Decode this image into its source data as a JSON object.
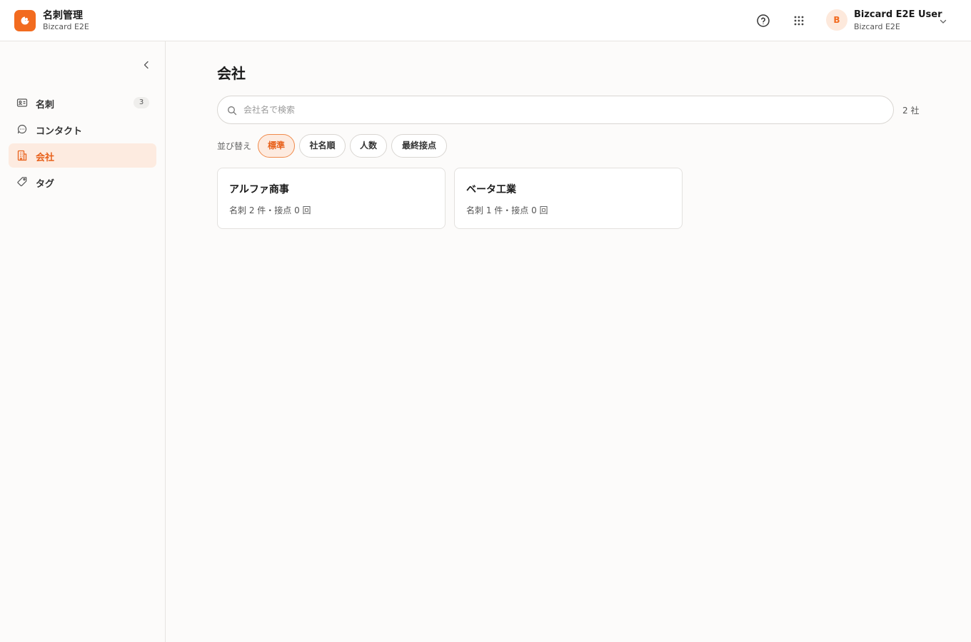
{
  "header": {
    "app_title": "名刺管理",
    "app_subtitle": "Bizcard E2E",
    "logo_icon": "brand-logo-icon",
    "help_icon": "help-circle-icon",
    "apps_icon": "grid-apps-icon",
    "user": {
      "avatar_initial": "B",
      "name": "Bizcard E2E User",
      "org": "Bizcard E2E"
    }
  },
  "sidebar": {
    "items": [
      {
        "label": "名刺",
        "icon": "id-card-icon",
        "badge": "3",
        "active": false
      },
      {
        "label": "コンタクト",
        "icon": "chat-bubble-icon",
        "active": false
      },
      {
        "label": "会社",
        "icon": "building-icon",
        "active": true
      },
      {
        "label": "タグ",
        "icon": "tag-icon",
        "active": false
      }
    ]
  },
  "main": {
    "title": "会社",
    "search": {
      "placeholder": "会社名で検索",
      "value": ""
    },
    "count": "2 社",
    "sort": {
      "label": "並び替え",
      "options": [
        "標準",
        "社名順",
        "人数",
        "最終接点"
      ],
      "selected": "標準"
    },
    "companies": [
      {
        "name": "アルファ商事",
        "meta": "名刺 2 件・接点 0 回"
      },
      {
        "name": "ベータ工業",
        "meta": "名刺 1 件・接点 0 回"
      }
    ]
  },
  "colors": {
    "accent": "#f26b1f",
    "accent_bg": "#fdebe0",
    "border": "#e6e4e1",
    "background": "#fcfbfa"
  }
}
